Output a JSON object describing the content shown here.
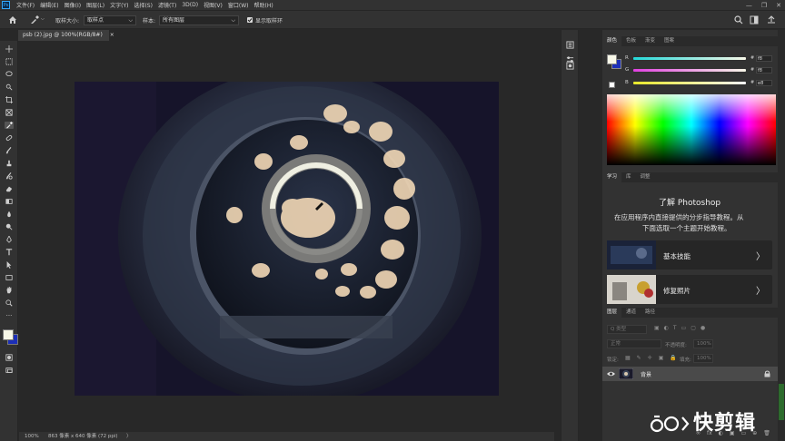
{
  "app": {
    "logo": "Ps"
  },
  "menu": [
    "文件(F)",
    "编辑(E)",
    "图像(I)",
    "图层(L)",
    "文字(Y)",
    "选择(S)",
    "滤镜(T)",
    "3D(D)",
    "视图(V)",
    "窗口(W)",
    "帮助(H)"
  ],
  "window_controls": [
    "—",
    "❐",
    "✕"
  ],
  "options": {
    "sample_size_label": "取样大小:",
    "sample_size_value": "取样点",
    "sample_label": "样本:",
    "sample_value": "所有图层",
    "show_ring_label": "显示取样环",
    "show_ring_checked": true
  },
  "document": {
    "tab_title": "psb (2).jpg @ 100%(RGB/8#)",
    "close": "×",
    "zoom": "100%",
    "info": "863 像素 x 640 像素 (72 ppi)",
    "arrow": "〉"
  },
  "color_panel": {
    "tabs": [
      "颜色",
      "色板",
      "渐变",
      "图案"
    ],
    "channels": [
      {
        "label": "R",
        "value": "f8",
        "hex": "#24d9d9"
      },
      {
        "label": "G",
        "value": "f8",
        "hex": "#e040e0"
      },
      {
        "label": "B",
        "value": "e8",
        "hex": "#e8e82a"
      }
    ],
    "hash": "#",
    "foreground": "#f8f8e8",
    "background": "#1c2fb8"
  },
  "learn_panel": {
    "tabs": [
      "学习",
      "库",
      "调整"
    ],
    "title": "了解 Photoshop",
    "description_line1": "在应用程序内直接提供的分步指导教程。从",
    "description_line2": "下面选取一个主题开始教程。",
    "cards": [
      {
        "label": "基本技能",
        "chevron": "〉"
      },
      {
        "label": "修复照片",
        "chevron": "〉"
      }
    ]
  },
  "layers_panel": {
    "tabs": [
      "图层",
      "通道",
      "路径"
    ],
    "filter_placeholder": "Q 类型",
    "blend_mode": "正常",
    "opacity_label": "不透明度:",
    "opacity_value": "100%",
    "lock_label": "锁定:",
    "fill_label": "填充:",
    "fill_value": "100%",
    "layer_name": "背景",
    "bottom_icons": [
      "fx",
      "◐",
      "▣",
      "▭",
      "⊕",
      "🗑"
    ]
  },
  "watermark": "快剪辑"
}
